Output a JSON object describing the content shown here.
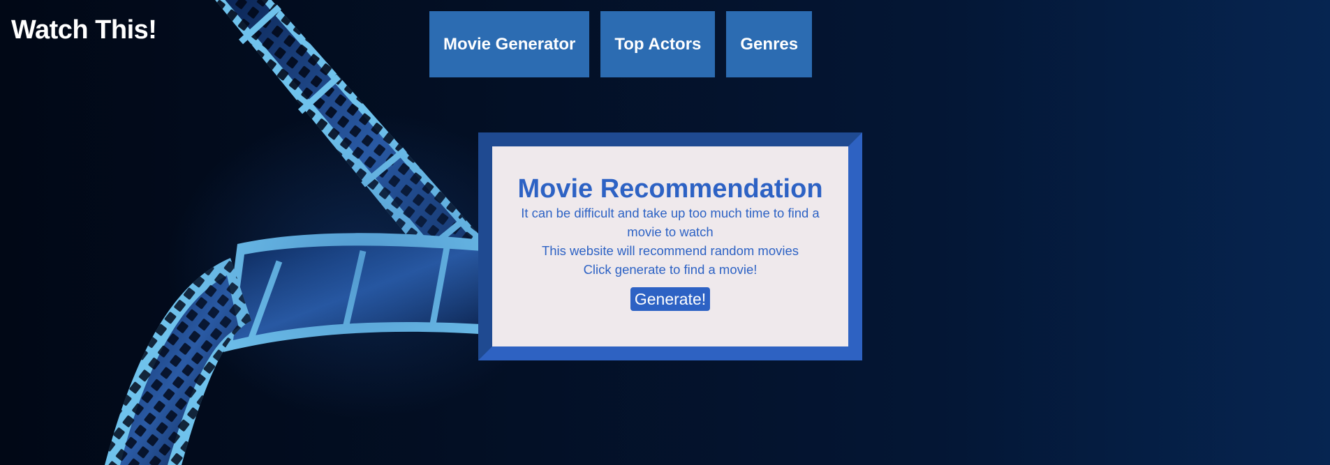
{
  "header": {
    "site_title": "Watch This!"
  },
  "nav": {
    "items": [
      {
        "label": "Movie Generator"
      },
      {
        "label": "Top Actors"
      },
      {
        "label": "Genres"
      }
    ]
  },
  "card": {
    "title": "Movie Recommendation",
    "lines": [
      "It can be difficult and take up too much time to find a movie to watch",
      "This website will recommend random movies",
      "Click generate to find a movie!"
    ],
    "generate_label": "Generate!"
  },
  "colors": {
    "nav_button_bg": "#2c6cb2",
    "card_accent": "#2d62c4",
    "card_bg": "#efe9ec",
    "page_bg": "#030f24"
  },
  "icons": {
    "background": "film-strip-icon"
  }
}
